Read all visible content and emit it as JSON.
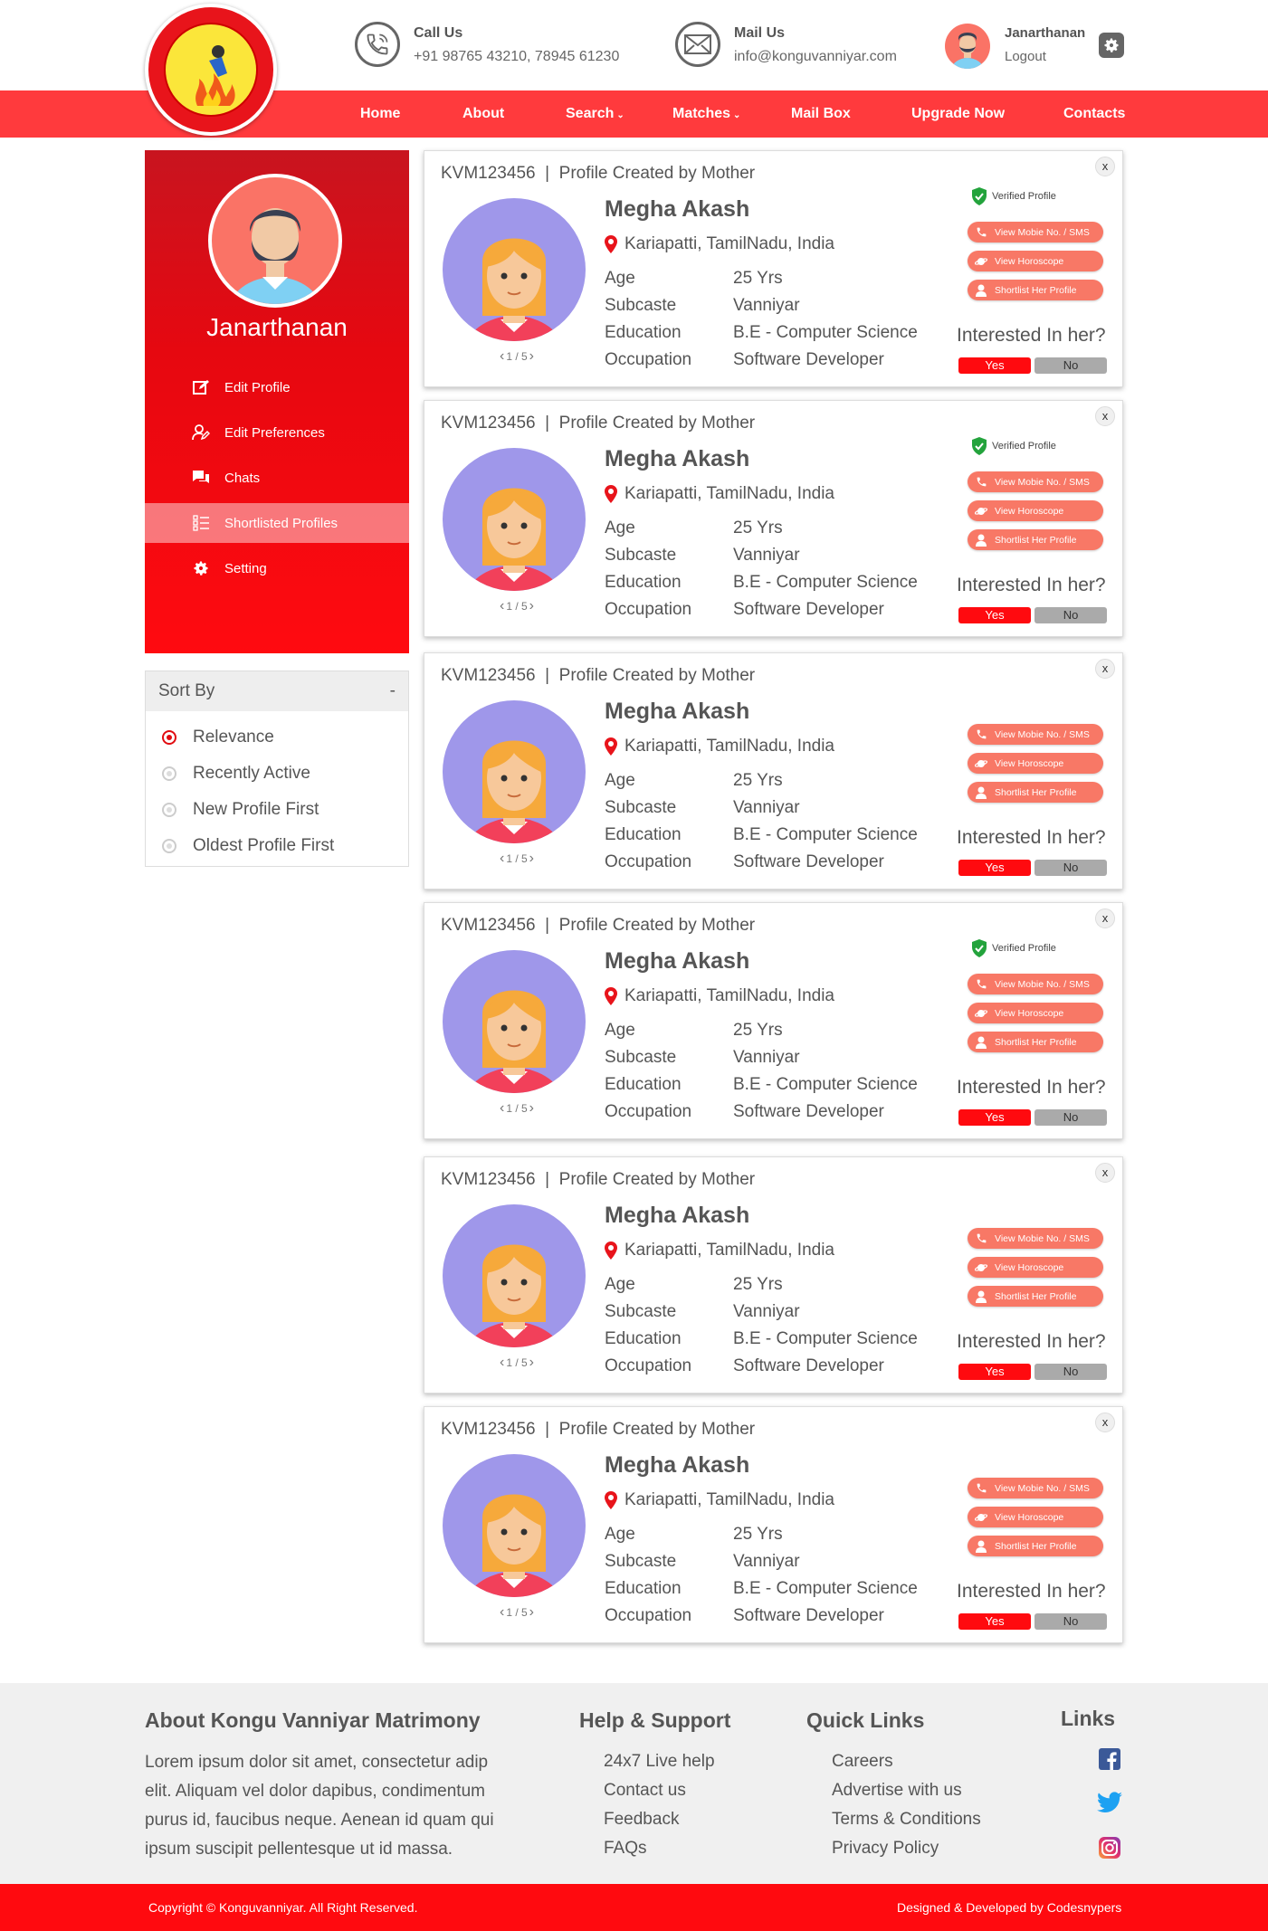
{
  "header": {
    "call": {
      "label": "Call Us",
      "value": "+91 98765 43210, 78945 61230"
    },
    "mail": {
      "label": "Mail Us",
      "value": "info@konguvanniyar.com"
    },
    "user": {
      "name": "Janarthanan",
      "logout": "Logout"
    }
  },
  "nav": [
    "Home",
    "About",
    "Search",
    "Matches",
    "Mail Box",
    "Upgrade Now",
    "Contacts"
  ],
  "sidebar": {
    "name": "Janarthanan",
    "items": [
      {
        "label": "Edit Profile",
        "icon": "edit-icon"
      },
      {
        "label": "Edit Preferences",
        "icon": "user-edit-icon"
      },
      {
        "label": "Chats",
        "icon": "chat-icon"
      },
      {
        "label": "Shortlisted Profiles",
        "icon": "list-icon",
        "active": true
      },
      {
        "label": "Setting",
        "icon": "gear-icon"
      }
    ]
  },
  "sort": {
    "title": "Sort By",
    "toggle": "-",
    "options": [
      "Relevance",
      "Recently Active",
      "New Profile First",
      "Oldest Profile First"
    ],
    "selected": "Relevance"
  },
  "profiles": [
    {
      "id": "KVM123456",
      "created": "Profile Created by Mother",
      "name": "Megha Akash",
      "location": "Kariapatti, TamilNadu, India",
      "age": "25 Yrs",
      "subcaste": "Vanniyar",
      "education": "B.E - Computer Science",
      "occupation": "Software Developer",
      "pager": "1 / 5",
      "verified": true
    },
    {
      "id": "KVM123456",
      "created": "Profile Created by Mother",
      "name": "Megha Akash",
      "location": "Kariapatti, TamilNadu, India",
      "age": "25 Yrs",
      "subcaste": "Vanniyar",
      "education": "B.E - Computer Science",
      "occupation": "Software Developer",
      "pager": "1 / 5",
      "verified": true
    },
    {
      "id": "KVM123456",
      "created": "Profile Created by Mother",
      "name": "Megha Akash",
      "location": "Kariapatti, TamilNadu, India",
      "age": "25 Yrs",
      "subcaste": "Vanniyar",
      "education": "B.E - Computer Science",
      "occupation": "Software Developer",
      "pager": "1 / 5",
      "verified": false
    },
    {
      "id": "KVM123456",
      "created": "Profile Created by Mother",
      "name": "Megha Akash",
      "location": "Kariapatti, TamilNadu, India",
      "age": "25 Yrs",
      "subcaste": "Vanniyar",
      "education": "B.E - Computer Science",
      "occupation": "Software Developer",
      "pager": "1 / 5",
      "verified": true
    },
    {
      "id": "KVM123456",
      "created": "Profile Created by Mother",
      "name": "Megha Akash",
      "location": "Kariapatti, TamilNadu, India",
      "age": "25 Yrs",
      "subcaste": "Vanniyar",
      "education": "B.E - Computer Science",
      "occupation": "Software Developer",
      "pager": "1 / 5",
      "verified": false
    },
    {
      "id": "KVM123456",
      "created": "Profile Created by Mother",
      "name": "Megha Akash",
      "location": "Kariapatti, TamilNadu, India",
      "age": "25 Yrs",
      "subcaste": "Vanniyar",
      "education": "B.E - Computer Science",
      "occupation": "Software Developer",
      "pager": "1 / 5",
      "verified": false
    }
  ],
  "card_labels": {
    "age": "Age",
    "subcaste": "Subcaste",
    "education": "Education",
    "occupation": "Occupation",
    "verified": "Verified Profile",
    "view_mobile": "View Mobie No. / SMS",
    "view_horoscope": "View Horoscope",
    "shortlist": "Shortlist Her Profile",
    "interest": "Interested In her?",
    "yes": "Yes",
    "no": "No",
    "close": "x"
  },
  "footer": {
    "about": {
      "title": "About Kongu Vanniyar Matrimony",
      "lines": [
        "Lorem ipsum dolor sit amet, consectetur adip",
        "elit. Aliquam vel dolor dapibus, condimentum",
        "purus id, faucibus neque. Aenean id quam qui",
        "ipsum suscipit pellentesque ut id massa."
      ]
    },
    "help": {
      "title": "Help & Support",
      "links": [
        "24x7 Live help",
        "Contact us",
        "Feedback",
        "FAQs"
      ]
    },
    "quick": {
      "title": "Quick Links",
      "links": [
        "Careers",
        "Advertise with us",
        "Terms & Conditions",
        "Privacy Policy"
      ]
    },
    "social": {
      "title": "Links",
      "icons": [
        "facebook-icon",
        "twitter-icon",
        "instagram-icon"
      ]
    },
    "copyright": "Copyright © Konguvanniyar. All Right Reserved.",
    "credit": "Designed & Developed by Codesnypers"
  },
  "colors": {
    "primary_red": "#ff0a0f",
    "nav_red": "#ff3a3d",
    "pill": "#f87866",
    "avatar_bg": "#9f97ea"
  }
}
